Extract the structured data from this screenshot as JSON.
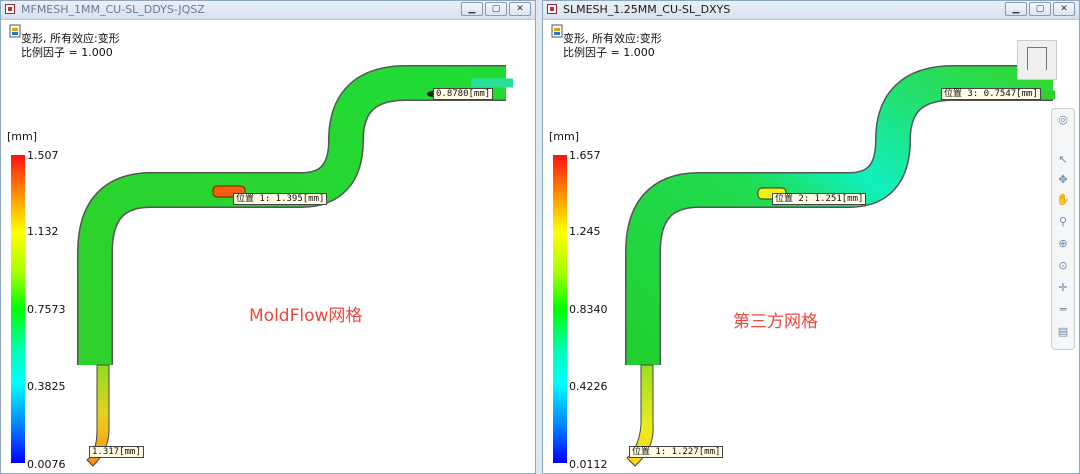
{
  "windows": [
    {
      "title": "MFMESH_1MM_CU-SL_DDYS-JQSZ",
      "result_lines": [
        "变形, 所有效应:变形",
        "比例因子 = 1.000"
      ],
      "unit": "[mm]",
      "scale": [
        "1.507",
        "1.132",
        "0.7573",
        "0.3825",
        "0.0076"
      ],
      "tags": [
        "0.8780[mm]",
        "位置 1: 1.395[mm]",
        "1.317[mm]"
      ],
      "watermark": "MoldFlow网格"
    },
    {
      "title": "SLMESH_1.25MM_CU-SL_DXYS",
      "result_lines": [
        "变形, 所有效应:变形",
        "比例因子 = 1.000"
      ],
      "unit": "[mm]",
      "scale": [
        "1.657",
        "1.245",
        "0.8340",
        "0.4226",
        "0.0112"
      ],
      "tags": [
        "位置 3: 0.7547[mm]",
        "位置 2: 1.251[mm]",
        "位置 1: 1.227[mm]"
      ],
      "watermark": "第三方网格"
    }
  ],
  "window_buttons": [
    "minimize",
    "maximize",
    "close"
  ],
  "nav_toolbar_icons": [
    "steering-wheel-icon",
    "select-arrow-icon",
    "rotate-icon",
    "pan-hand-icon",
    "zoom-icon",
    "zoom-window-icon",
    "zoom-all-icon",
    "center-icon",
    "measure-icon",
    "layers-icon"
  ],
  "colors": {
    "red": "#ff1010",
    "green": "#00ff00",
    "blue": "#0000ff",
    "watermark": "#f0483c"
  }
}
